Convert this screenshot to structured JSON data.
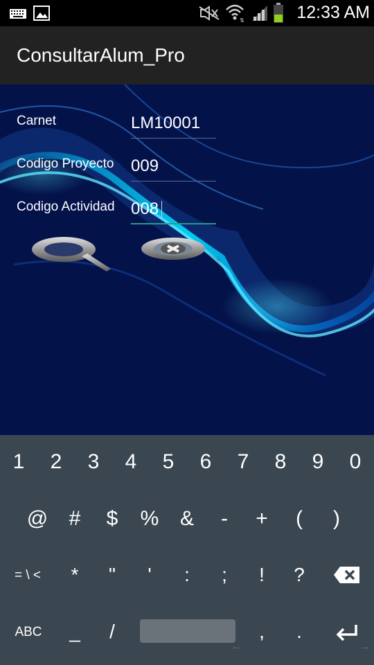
{
  "status_bar": {
    "time": "12:33 AM",
    "icons": [
      "keyboard-icon",
      "image-icon",
      "silent-mode-icon",
      "wifi-icon",
      "signal-icon",
      "battery-icon"
    ]
  },
  "app": {
    "title": "ConsultarAlum_Pro"
  },
  "form": {
    "carnet_label": "Carnet",
    "carnet_value": "LM10001",
    "proyecto_label": "Codigo Proyecto",
    "proyecto_value": "009",
    "actividad_label": "Codigo Actividad",
    "actividad_value": "008"
  },
  "buttons": {
    "search": "search-icon",
    "clear": "clear-icon"
  },
  "keyboard": {
    "row1": [
      "1",
      "2",
      "3",
      "4",
      "5",
      "6",
      "7",
      "8",
      "9",
      "0"
    ],
    "row2": [
      "@",
      "#",
      "$",
      "%",
      "&",
      "-",
      "+",
      "(",
      ")"
    ],
    "row3": [
      "= \\ <",
      "*",
      "\"",
      "'",
      ":",
      ";",
      "!",
      "?"
    ],
    "row4_abc": "ABC",
    "row4_underscore": "_",
    "row4_slash": "/",
    "row4_comma": ",",
    "row4_period": ".",
    "icons": [
      "backspace-icon",
      "enter-icon"
    ]
  },
  "colors": {
    "statusbar": "#000000",
    "actionbar": "#222222",
    "keyboard": "#3a4650",
    "active_underline": "#2a9a8a"
  }
}
